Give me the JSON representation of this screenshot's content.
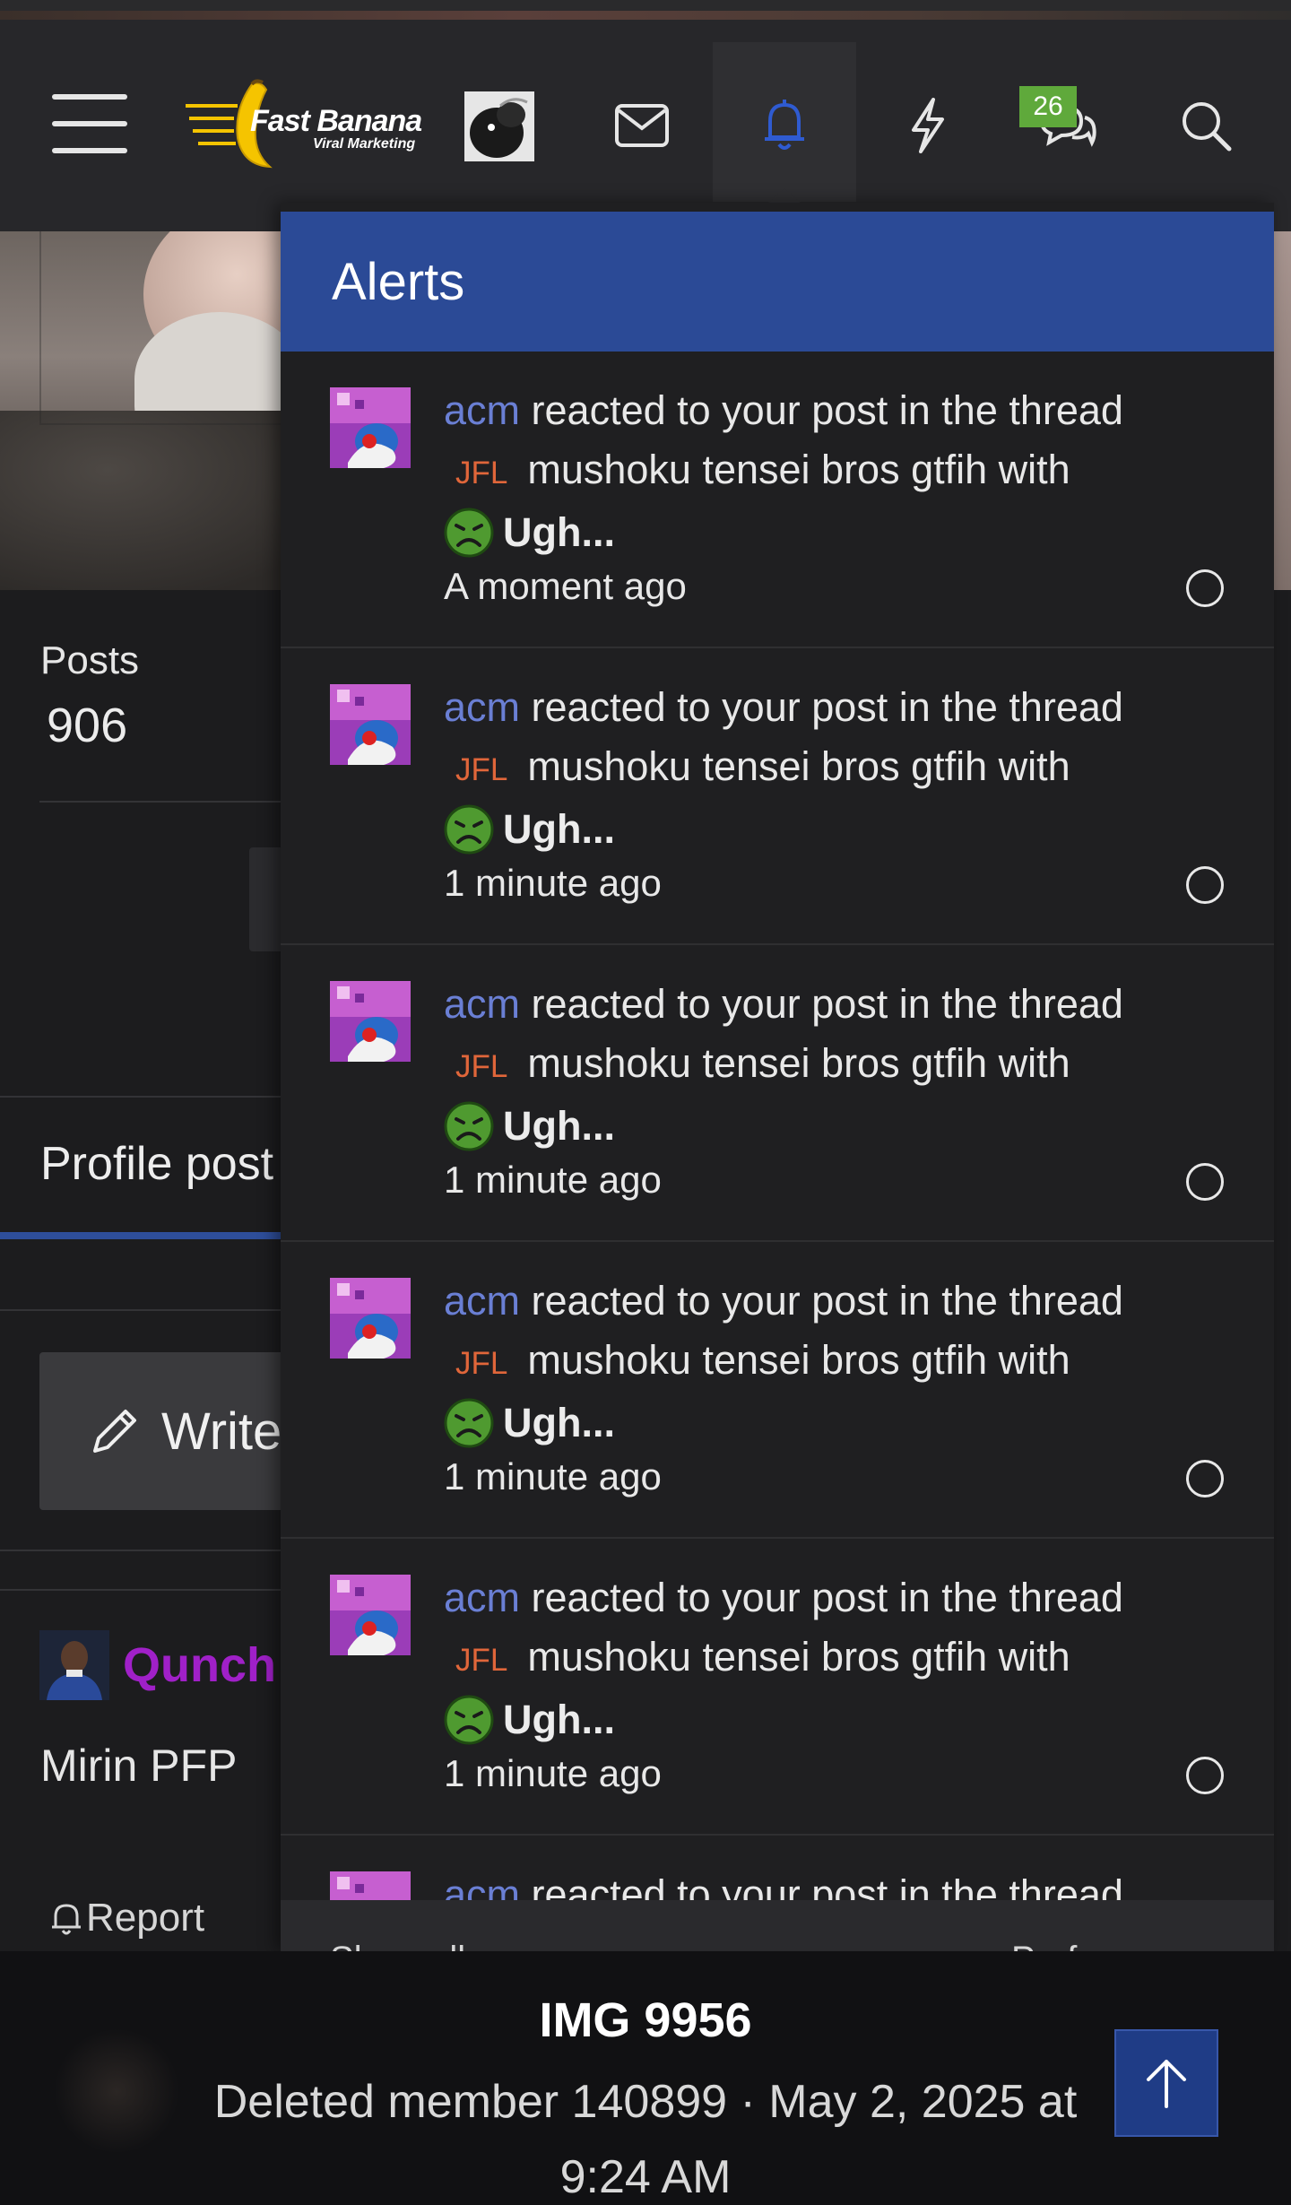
{
  "header": {
    "logo_text": "Fast Banana",
    "logo_subtext": "Viral Marketing",
    "conversations_badge": "26",
    "icons": [
      "menu-icon",
      "envelope-icon",
      "bell-icon",
      "lightning-icon",
      "chat-icon",
      "search-icon"
    ]
  },
  "profile": {
    "posts_label": "Posts",
    "posts_value": "906",
    "tab_label": "Profile post",
    "write_label": "Write",
    "post_author": "Qunch",
    "post_text": "Mirin PFP",
    "report_label": "Report"
  },
  "alerts": {
    "title": "Alerts",
    "items": [
      {
        "user": "acm",
        "action": "reacted to your post in the thread",
        "prefix": "JFL",
        "thread": "mushoku tensei bros gtfih",
        "with": "with",
        "reaction": "Ugh...",
        "time": "A moment ago"
      },
      {
        "user": "acm",
        "action": "reacted to your post in the thread",
        "prefix": "JFL",
        "thread": "mushoku tensei bros gtfih",
        "with": "with",
        "reaction": "Ugh...",
        "time": "1 minute ago"
      },
      {
        "user": "acm",
        "action": "reacted to your post in the thread",
        "prefix": "JFL",
        "thread": "mushoku tensei bros gtfih",
        "with": "with",
        "reaction": "Ugh...",
        "time": "1 minute ago"
      },
      {
        "user": "acm",
        "action": "reacted to your post in the thread",
        "prefix": "JFL",
        "thread": "mushoku tensei bros gtfih",
        "with": "with",
        "reaction": "Ugh...",
        "time": "1 minute ago"
      },
      {
        "user": "acm",
        "action": "reacted to your post in the thread",
        "prefix": "JFL",
        "thread": "mushoku tensei bros gtfih",
        "with": "with",
        "reaction": "Ugh...",
        "time": "1 minute ago"
      },
      {
        "user": "acm",
        "action": "reacted to your post in the thread",
        "prefix": "",
        "thread": "",
        "with": "",
        "reaction": "",
        "time": ""
      }
    ],
    "footer_left": "Show all",
    "footer_right": "Preferences"
  },
  "lightbox": {
    "title": "IMG 9956",
    "meta": "Deleted member 140899 · May 2, 2025 at 9:24 AM"
  },
  "colors": {
    "accent_blue": "#2b4a96",
    "username_blue": "#6a7fd4",
    "prefix_orange": "#e0663a",
    "badge_green": "#5fa93b",
    "poster_purple": "#a020c8"
  }
}
